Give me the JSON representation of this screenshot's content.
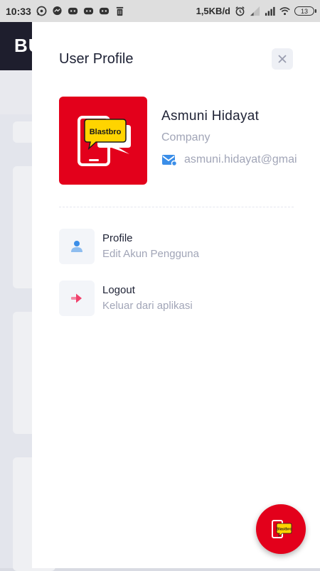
{
  "status_bar": {
    "time": "10:33",
    "network_speed": "1,5KB/d",
    "battery_level": "13",
    "icons_left": [
      "whatsapp-icon",
      "messenger-icon",
      "discord-icon",
      "discord-icon",
      "discord-icon",
      "trash-icon"
    ],
    "icons_right": [
      "alarm-icon",
      "signal-icon",
      "signal-icon",
      "wifi-icon",
      "battery-icon"
    ]
  },
  "background_app": {
    "logo_text": "BU"
  },
  "drawer": {
    "title": "User Profile",
    "close_icon": "close-icon",
    "user": {
      "name": "Asmuni Hidayat",
      "role": "Company",
      "email": "asmuni.hidayat@gmai",
      "avatar_brand": "Blastbro"
    },
    "menu": [
      {
        "title": "Profile",
        "subtitle": "Edit Akun Pengguna",
        "icon": "user-icon",
        "icon_color": "#3b8ee8"
      },
      {
        "title": "Logout",
        "subtitle": "Keluar dari aplikasi",
        "icon": "arrow-right-icon",
        "icon_color": "#f1416c"
      }
    ]
  },
  "fab": {
    "brand": "Blastbro"
  },
  "colors": {
    "brand_red": "#e3001b",
    "brand_yellow": "#ffd400",
    "primary_blue": "#3b8ee8",
    "danger": "#f1416c",
    "text_dark": "#1e2235",
    "text_muted": "#a1a5b7"
  }
}
